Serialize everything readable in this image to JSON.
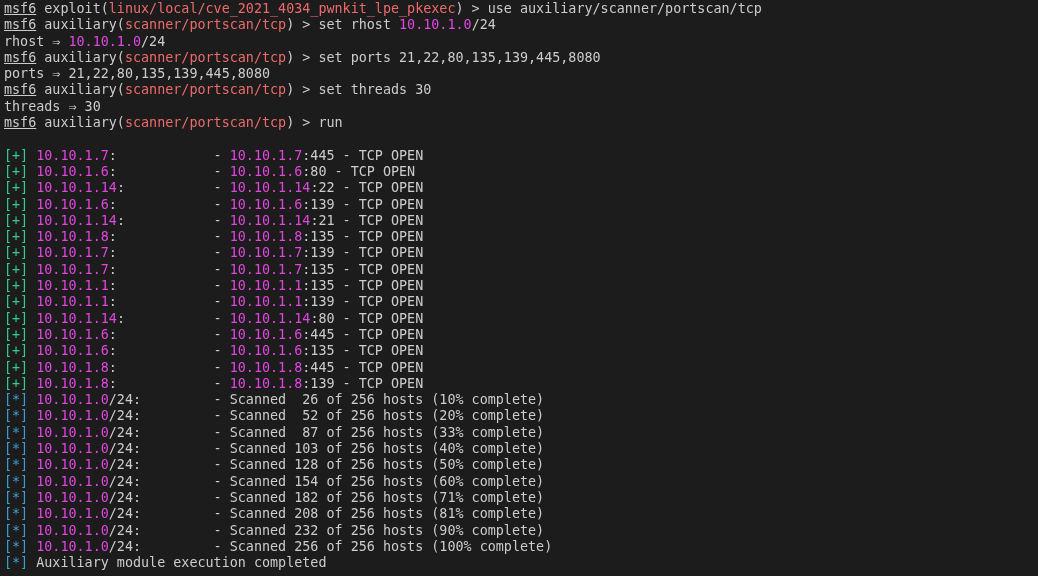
{
  "terminal": {
    "session": [
      [
        {
          "kind": "prompt",
          "text": "msf6"
        },
        {
          "kind": "plain",
          "text": " exploit("
        },
        {
          "kind": "module",
          "text": "linux/local/cve_2021_4034_pwnkit_lpe_pkexec"
        },
        {
          "kind": "plain",
          "text": ") > use auxiliary/scanner/portscan/tcp"
        }
      ],
      [
        {
          "kind": "prompt",
          "text": "msf6"
        },
        {
          "kind": "plain",
          "text": " auxiliary("
        },
        {
          "kind": "module",
          "text": "scanner/portscan/tcp"
        },
        {
          "kind": "plain",
          "text": ") > set rhost "
        },
        {
          "kind": "address",
          "text": "10.10.1.0"
        },
        {
          "kind": "plain",
          "text": "/24"
        }
      ],
      [
        {
          "kind": "plain",
          "text": "rhost ⇒ "
        },
        {
          "kind": "address",
          "text": "10.10.1.0"
        },
        {
          "kind": "plain",
          "text": "/24"
        }
      ],
      [
        {
          "kind": "prompt",
          "text": "msf6"
        },
        {
          "kind": "plain",
          "text": " auxiliary("
        },
        {
          "kind": "module",
          "text": "scanner/portscan/tcp"
        },
        {
          "kind": "plain",
          "text": ") > set ports 21,22,80,135,139,445,8080"
        }
      ],
      [
        {
          "kind": "plain",
          "text": "ports ⇒ 21,22,80,135,139,445,8080"
        }
      ],
      [
        {
          "kind": "prompt",
          "text": "msf6"
        },
        {
          "kind": "plain",
          "text": " auxiliary("
        },
        {
          "kind": "module",
          "text": "scanner/portscan/tcp"
        },
        {
          "kind": "plain",
          "text": ") > set threads 30"
        }
      ],
      [
        {
          "kind": "plain",
          "text": "threads ⇒ 30"
        }
      ],
      [
        {
          "kind": "prompt",
          "text": "msf6"
        },
        {
          "kind": "plain",
          "text": " auxiliary("
        },
        {
          "kind": "module",
          "text": "scanner/portscan/tcp"
        },
        {
          "kind": "plain",
          "text": ") > run"
        }
      ]
    ],
    "output": [
      [
        {
          "kind": "good",
          "text": "[+] "
        },
        {
          "kind": "address",
          "text": "10.10.1.7"
        },
        {
          "kind": "plain",
          "text": ":            - "
        },
        {
          "kind": "address",
          "text": "10.10.1.7"
        },
        {
          "kind": "plain",
          "text": ":445 - TCP OPEN"
        }
      ],
      [
        {
          "kind": "good",
          "text": "[+] "
        },
        {
          "kind": "address",
          "text": "10.10.1.6"
        },
        {
          "kind": "plain",
          "text": ":            - "
        },
        {
          "kind": "address",
          "text": "10.10.1.6"
        },
        {
          "kind": "plain",
          "text": ":80 - TCP OPEN"
        }
      ],
      [
        {
          "kind": "good",
          "text": "[+] "
        },
        {
          "kind": "address",
          "text": "10.10.1.14"
        },
        {
          "kind": "plain",
          "text": ":           - "
        },
        {
          "kind": "address",
          "text": "10.10.1.14"
        },
        {
          "kind": "plain",
          "text": ":22 - TCP OPEN"
        }
      ],
      [
        {
          "kind": "good",
          "text": "[+] "
        },
        {
          "kind": "address",
          "text": "10.10.1.6"
        },
        {
          "kind": "plain",
          "text": ":            - "
        },
        {
          "kind": "address",
          "text": "10.10.1.6"
        },
        {
          "kind": "plain",
          "text": ":139 - TCP OPEN"
        }
      ],
      [
        {
          "kind": "good",
          "text": "[+] "
        },
        {
          "kind": "address",
          "text": "10.10.1.14"
        },
        {
          "kind": "plain",
          "text": ":           - "
        },
        {
          "kind": "address",
          "text": "10.10.1.14"
        },
        {
          "kind": "plain",
          "text": ":21 - TCP OPEN"
        }
      ],
      [
        {
          "kind": "good",
          "text": "[+] "
        },
        {
          "kind": "address",
          "text": "10.10.1.8"
        },
        {
          "kind": "plain",
          "text": ":            - "
        },
        {
          "kind": "address",
          "text": "10.10.1.8"
        },
        {
          "kind": "plain",
          "text": ":135 - TCP OPEN"
        }
      ],
      [
        {
          "kind": "good",
          "text": "[+] "
        },
        {
          "kind": "address",
          "text": "10.10.1.7"
        },
        {
          "kind": "plain",
          "text": ":            - "
        },
        {
          "kind": "address",
          "text": "10.10.1.7"
        },
        {
          "kind": "plain",
          "text": ":139 - TCP OPEN"
        }
      ],
      [
        {
          "kind": "good",
          "text": "[+] "
        },
        {
          "kind": "address",
          "text": "10.10.1.7"
        },
        {
          "kind": "plain",
          "text": ":            - "
        },
        {
          "kind": "address",
          "text": "10.10.1.7"
        },
        {
          "kind": "plain",
          "text": ":135 - TCP OPEN"
        }
      ],
      [
        {
          "kind": "good",
          "text": "[+] "
        },
        {
          "kind": "address",
          "text": "10.10.1.1"
        },
        {
          "kind": "plain",
          "text": ":            - "
        },
        {
          "kind": "address",
          "text": "10.10.1.1"
        },
        {
          "kind": "plain",
          "text": ":135 - TCP OPEN"
        }
      ],
      [
        {
          "kind": "good",
          "text": "[+] "
        },
        {
          "kind": "address",
          "text": "10.10.1.1"
        },
        {
          "kind": "plain",
          "text": ":            - "
        },
        {
          "kind": "address",
          "text": "10.10.1.1"
        },
        {
          "kind": "plain",
          "text": ":139 - TCP OPEN"
        }
      ],
      [
        {
          "kind": "good",
          "text": "[+] "
        },
        {
          "kind": "address",
          "text": "10.10.1.14"
        },
        {
          "kind": "plain",
          "text": ":           - "
        },
        {
          "kind": "address",
          "text": "10.10.1.14"
        },
        {
          "kind": "plain",
          "text": ":80 - TCP OPEN"
        }
      ],
      [
        {
          "kind": "good",
          "text": "[+] "
        },
        {
          "kind": "address",
          "text": "10.10.1.6"
        },
        {
          "kind": "plain",
          "text": ":            - "
        },
        {
          "kind": "address",
          "text": "10.10.1.6"
        },
        {
          "kind": "plain",
          "text": ":445 - TCP OPEN"
        }
      ],
      [
        {
          "kind": "good",
          "text": "[+] "
        },
        {
          "kind": "address",
          "text": "10.10.1.6"
        },
        {
          "kind": "plain",
          "text": ":            - "
        },
        {
          "kind": "address",
          "text": "10.10.1.6"
        },
        {
          "kind": "plain",
          "text": ":135 - TCP OPEN"
        }
      ],
      [
        {
          "kind": "good",
          "text": "[+] "
        },
        {
          "kind": "address",
          "text": "10.10.1.8"
        },
        {
          "kind": "plain",
          "text": ":            - "
        },
        {
          "kind": "address",
          "text": "10.10.1.8"
        },
        {
          "kind": "plain",
          "text": ":445 - TCP OPEN"
        }
      ],
      [
        {
          "kind": "good",
          "text": "[+] "
        },
        {
          "kind": "address",
          "text": "10.10.1.8"
        },
        {
          "kind": "plain",
          "text": ":            - "
        },
        {
          "kind": "address",
          "text": "10.10.1.8"
        },
        {
          "kind": "plain",
          "text": ":139 - TCP OPEN"
        }
      ],
      [
        {
          "kind": "info",
          "text": "[*] "
        },
        {
          "kind": "address",
          "text": "10.10.1.0"
        },
        {
          "kind": "plain",
          "text": "/24:         - Scanned  26 of 256 hosts (10% complete)"
        }
      ],
      [
        {
          "kind": "info",
          "text": "[*] "
        },
        {
          "kind": "address",
          "text": "10.10.1.0"
        },
        {
          "kind": "plain",
          "text": "/24:         - Scanned  52 of 256 hosts (20% complete)"
        }
      ],
      [
        {
          "kind": "info",
          "text": "[*] "
        },
        {
          "kind": "address",
          "text": "10.10.1.0"
        },
        {
          "kind": "plain",
          "text": "/24:         - Scanned  87 of 256 hosts (33% complete)"
        }
      ],
      [
        {
          "kind": "info",
          "text": "[*] "
        },
        {
          "kind": "address",
          "text": "10.10.1.0"
        },
        {
          "kind": "plain",
          "text": "/24:         - Scanned 103 of 256 hosts (40% complete)"
        }
      ],
      [
        {
          "kind": "info",
          "text": "[*] "
        },
        {
          "kind": "address",
          "text": "10.10.1.0"
        },
        {
          "kind": "plain",
          "text": "/24:         - Scanned 128 of 256 hosts (50% complete)"
        }
      ],
      [
        {
          "kind": "info",
          "text": "[*] "
        },
        {
          "kind": "address",
          "text": "10.10.1.0"
        },
        {
          "kind": "plain",
          "text": "/24:         - Scanned 154 of 256 hosts (60% complete)"
        }
      ],
      [
        {
          "kind": "info",
          "text": "[*] "
        },
        {
          "kind": "address",
          "text": "10.10.1.0"
        },
        {
          "kind": "plain",
          "text": "/24:         - Scanned 182 of 256 hosts (71% complete)"
        }
      ],
      [
        {
          "kind": "info",
          "text": "[*] "
        },
        {
          "kind": "address",
          "text": "10.10.1.0"
        },
        {
          "kind": "plain",
          "text": "/24:         - Scanned 208 of 256 hosts (81% complete)"
        }
      ],
      [
        {
          "kind": "info",
          "text": "[*] "
        },
        {
          "kind": "address",
          "text": "10.10.1.0"
        },
        {
          "kind": "plain",
          "text": "/24:         - Scanned 232 of 256 hosts (90% complete)"
        }
      ],
      [
        {
          "kind": "info",
          "text": "[*] "
        },
        {
          "kind": "address",
          "text": "10.10.1.0"
        },
        {
          "kind": "plain",
          "text": "/24:         - Scanned 256 of 256 hosts (100% complete)"
        }
      ],
      [
        {
          "kind": "info",
          "text": "[*] "
        },
        {
          "kind": "plain",
          "text": "Auxiliary module execution completed"
        }
      ]
    ]
  }
}
